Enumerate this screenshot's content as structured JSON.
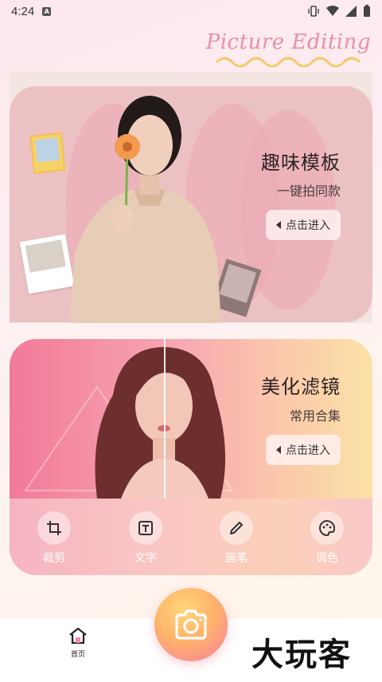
{
  "status_bar": {
    "time": "4:24",
    "app_icon_letter": "A"
  },
  "header": {
    "brand_title": "Picture Editing"
  },
  "cards": {
    "template": {
      "title": "趣味模板",
      "subtitle": "一键拍同款",
      "enter_label": "点击进入"
    },
    "filter": {
      "title": "美化滤镜",
      "subtitle": "常用合集",
      "enter_label": "点击进入"
    }
  },
  "tools": [
    {
      "label": "裁剪",
      "icon": "crop-icon"
    },
    {
      "label": "文字",
      "icon": "text-icon"
    },
    {
      "label": "画笔",
      "icon": "pen-icon"
    },
    {
      "label": "调色",
      "icon": "palette-icon"
    }
  ],
  "bottom_nav": {
    "home_label": "首页",
    "camera_icon": "camera-icon"
  },
  "watermark": "大玩客",
  "colors": {
    "accent_pink": "#f27a99",
    "brand_text": "#e98fa6",
    "fab_orange": "#ffb36a"
  }
}
